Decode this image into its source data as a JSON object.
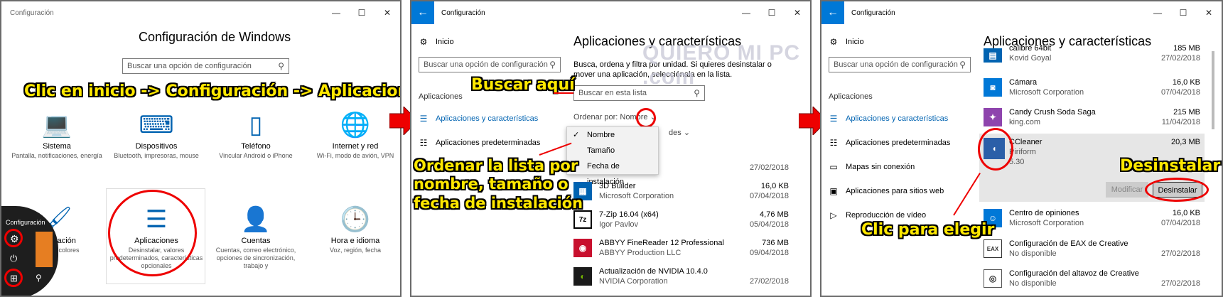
{
  "colors": {
    "accent": "#0078d7",
    "annotation": "#ffe800",
    "highlight": "#e00000"
  },
  "panel1": {
    "title": "Configuración",
    "heading": "Configuración de Windows",
    "search_placeholder": "Buscar una opción de configuración",
    "annotation": "Clic en inicio -> Configuración -> Aplicaciones",
    "tiles": [
      {
        "icon": "laptop-icon",
        "title": "Sistema",
        "desc": "Pantalla, notificaciones, energía"
      },
      {
        "icon": "devices-icon",
        "title": "Dispositivos",
        "desc": "Bluetooth, impresoras, mouse"
      },
      {
        "icon": "phone-icon",
        "title": "Teléfono",
        "desc": "Vincular Android o iPhone"
      },
      {
        "icon": "globe-icon",
        "title": "Internet y red",
        "desc": "Wi-Fi, modo de avión, VPN"
      },
      {
        "icon": "paint-icon",
        "title": "…alización",
        "desc": "…ondo, colores"
      },
      {
        "icon": "apps-icon",
        "title": "Aplicaciones",
        "desc": "Desinstalar, valores predeterminados, características opcionales"
      },
      {
        "icon": "person-icon",
        "title": "Cuentas",
        "desc": "Cuentas, correo electrónico, opciones de sincronización, trabajo y"
      },
      {
        "icon": "clock-icon",
        "title": "Hora e idioma",
        "desc": "Voz, región, fecha"
      }
    ],
    "start_menu_label": "Configuración"
  },
  "panel2": {
    "title": "Configuración",
    "home": "Inicio",
    "search_placeholder": "Buscar una opción de configuración",
    "section": "Aplicaciones",
    "nav": [
      "Aplicaciones y características",
      "Aplicaciones predeterminadas"
    ],
    "heading": "Aplicaciones y características",
    "desc": "Busca, ordena y filtra por unidad. Si quieres desinstalar o mover una aplicación, selecciónala en la lista.",
    "list_search_placeholder": "Buscar en esta lista",
    "sort_label": "Ordenar por: Nombre",
    "filter_fragment": "des",
    "sort_options": [
      "Nombre",
      "Tamaño",
      "Fecha de instalación"
    ],
    "annotation_search": "Buscar aquí",
    "annotation_sort": "Ordenar la lista por\nnombre, tamaño o\nfecha de instalación",
    "watermark": "QUIERO MI PC .com",
    "first_date": "27/02/2018",
    "apps": [
      {
        "name": "3D Builder",
        "publisher": "Microsoft Corporation",
        "size": "16,0 KB",
        "date": "07/04/2018",
        "icon": "3d-builder-icon",
        "color": "#0063b1"
      },
      {
        "name": "7-Zip 16.04 (x64)",
        "publisher": "Igor Pavlov",
        "size": "4,76 MB",
        "date": "05/04/2018",
        "icon": "7zip-icon",
        "color": "#222222"
      },
      {
        "name": "ABBYY FineReader 12 Professional",
        "publisher": "ABBYY Production LLC",
        "size": "736 MB",
        "date": "09/04/2018",
        "icon": "abbyy-icon",
        "color": "#c8102e"
      },
      {
        "name": "Actualización de NVIDIA 10.4.0",
        "publisher": "NVIDIA Corporation",
        "size": "",
        "date": "27/02/2018",
        "icon": "nvidia-icon",
        "color": "#1a1a1a"
      }
    ]
  },
  "panel3": {
    "title": "Configuración",
    "home": "Inicio",
    "search_placeholder": "Buscar una opción de configuración",
    "section": "Aplicaciones",
    "nav": [
      "Aplicaciones y características",
      "Aplicaciones predeterminadas",
      "Mapas sin conexión",
      "Aplicaciones para sitios web",
      "Reproducción de vídeo"
    ],
    "heading": "Aplicaciones y características",
    "annotation_uninstall": "Desinstalar",
    "annotation_select": "Clic para elegir",
    "modify_label": "Modificar",
    "uninstall_label": "Desinstalar",
    "apps": [
      {
        "name": "calibre 64bit",
        "publisher": "Kovid Goyal",
        "size": "185 MB",
        "date": "27/02/2018",
        "icon": "calibre-icon",
        "color": "#0063b1"
      },
      {
        "name": "Cámara",
        "publisher": "Microsoft Corporation",
        "size": "16,0 KB",
        "date": "07/04/2018",
        "icon": "camera-icon",
        "color": "#0078d7"
      },
      {
        "name": "Candy Crush Soda Saga",
        "publisher": "king.com",
        "size": "215 MB",
        "date": "11/04/2018",
        "icon": "candy-icon",
        "color": "#8e44ad"
      },
      {
        "name": "CCleaner",
        "publisher": "Piriform",
        "size": "20,3 MB",
        "date": "",
        "version": "5.30",
        "icon": "ccleaner-icon",
        "color": "#2b5fa8"
      },
      {
        "name": "Centro de opiniones",
        "publisher": "Microsoft Corporation",
        "size": "16,0 KB",
        "date": "07/04/2018",
        "icon": "feedback-icon",
        "color": "#0078d7"
      },
      {
        "name": "Configuración de EAX de Creative",
        "publisher": "No disponible",
        "size": "",
        "date": "27/02/2018",
        "icon": "eax-icon",
        "color": "#333333"
      },
      {
        "name": "Configuración del altavoz de Creative",
        "publisher": "No disponible",
        "size": "",
        "date": "27/02/2018",
        "icon": "speaker-icon",
        "color": "#555555"
      }
    ]
  }
}
